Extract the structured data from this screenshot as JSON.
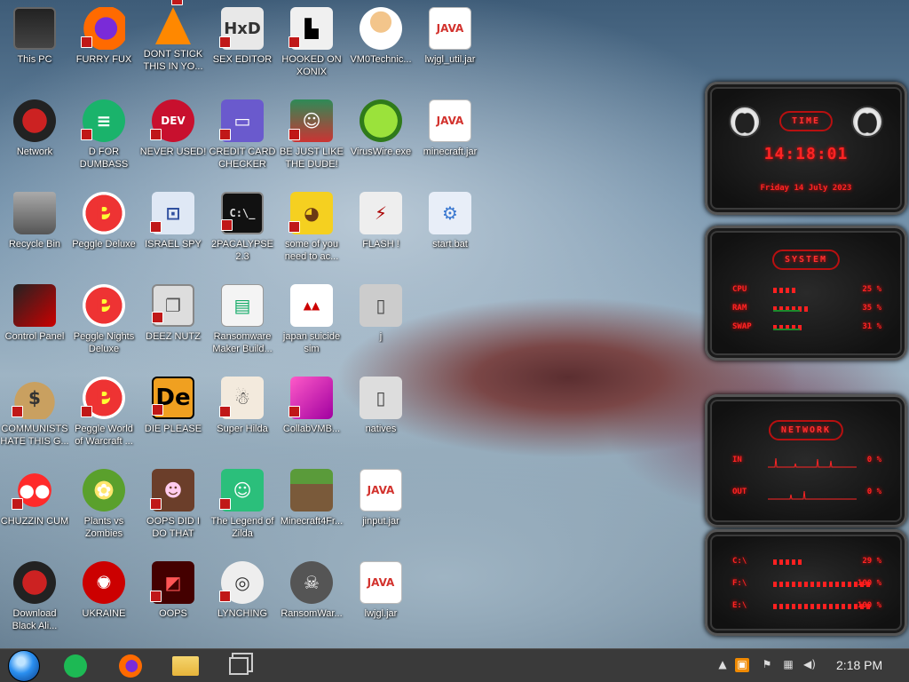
{
  "desktop": {
    "icons": [
      {
        "label": "This PC",
        "glyph": "",
        "style": "g-pc",
        "shortcut": false
      },
      {
        "label": "FURRY FUX",
        "glyph": "",
        "style": "g-fox",
        "shortcut": true
      },
      {
        "label": "DONT STICK THIS IN YO...",
        "glyph": "",
        "style": "g-vlc",
        "shortcut": true
      },
      {
        "label": "SEX EDITOR",
        "glyph": "HxD",
        "style": "g-hxd",
        "shortcut": true
      },
      {
        "label": "HOOKED ON XONIX",
        "glyph": "▙",
        "style": "g-hook",
        "shortcut": true
      },
      {
        "label": "VM0Technic...",
        "glyph": "",
        "style": "g-doc",
        "shortcut": false
      },
      {
        "label": "lwjgl_util.jar",
        "glyph": "JAVA",
        "style": "g-java",
        "shortcut": false
      },
      {
        "label": "Network",
        "glyph": "",
        "style": "g-net",
        "shortcut": false
      },
      {
        "label": "D FOR DUMBASS",
        "glyph": "≡",
        "style": "g-green",
        "shortcut": true
      },
      {
        "label": "NEVER USED!",
        "glyph": "DEV",
        "style": "g-dev",
        "shortcut": true
      },
      {
        "label": "CREDIT CARD CHECKER",
        "glyph": "▭",
        "style": "g-card",
        "shortcut": true
      },
      {
        "label": "BE JUST LIKE THE DUDE!",
        "glyph": "☺",
        "style": "g-elf",
        "shortcut": true
      },
      {
        "label": "VirusWire.exe",
        "glyph": "",
        "style": "g-lime",
        "shortcut": false
      },
      {
        "label": "minecraft.jar",
        "glyph": "JAVA",
        "style": "g-java",
        "shortcut": false
      },
      {
        "label": "Recycle Bin",
        "glyph": "",
        "style": "g-bin",
        "shortcut": false
      },
      {
        "label": "Peggle Deluxe",
        "glyph": "P",
        "style": "g-peggle",
        "shortcut": false
      },
      {
        "label": "ISRAEL SPY",
        "glyph": "⊡",
        "style": "g-spy",
        "shortcut": true
      },
      {
        "label": "2PACALYPSE 2.3",
        "glyph": "C:\\_",
        "style": "g-cmd",
        "shortcut": true
      },
      {
        "label": "some of you need to ac...",
        "glyph": "◕",
        "style": "g-dog",
        "shortcut": true
      },
      {
        "label": "FLASH !",
        "glyph": "⚡",
        "style": "g-flash",
        "shortcut": false
      },
      {
        "label": "start.bat",
        "glyph": "⚙",
        "style": "g-gear",
        "shortcut": false
      },
      {
        "label": "Control Panel",
        "glyph": "",
        "style": "g-cp",
        "shortcut": false
      },
      {
        "label": "Peggle Nights Deluxe",
        "glyph": "P",
        "style": "g-peggle",
        "shortcut": false
      },
      {
        "label": "DEEZ NUTZ",
        "glyph": "❐",
        "style": "g-deez",
        "shortcut": true
      },
      {
        "label": "Ransomware Maker Build...",
        "glyph": "▤",
        "style": "g-rmb",
        "shortcut": false
      },
      {
        "label": "japan suicide sim",
        "glyph": "▲▲",
        "style": "g-japan",
        "shortcut": false
      },
      {
        "label": "j",
        "glyph": "▯",
        "style": "g-j",
        "shortcut": false
      },
      {
        "label": "",
        "glyph": "",
        "style": "",
        "shortcut": false
      },
      {
        "label": "COMMUNISTS HATE THIS G...",
        "glyph": "$",
        "style": "g-money",
        "shortcut": true
      },
      {
        "label": "Peggle World of Warcraft ...",
        "glyph": "P",
        "style": "g-peggle",
        "shortcut": true
      },
      {
        "label": "DIE PLEASE",
        "glyph": "De",
        "style": "g-de",
        "shortcut": true
      },
      {
        "label": "Super Hilda",
        "glyph": "☃",
        "style": "g-hilda",
        "shortcut": true
      },
      {
        "label": "CollabVMB...",
        "glyph": "",
        "style": "g-collab",
        "shortcut": true
      },
      {
        "label": "natives",
        "glyph": "▯",
        "style": "g-nat",
        "shortcut": false
      },
      {
        "label": "",
        "glyph": "",
        "style": "",
        "shortcut": false
      },
      {
        "label": "CHUZZIN CUM",
        "glyph": "●●",
        "style": "g-chuz",
        "shortcut": true
      },
      {
        "label": "Plants vs Zombies",
        "glyph": "✿",
        "style": "g-pvz",
        "shortcut": false
      },
      {
        "label": "OOPS DID I DO THAT",
        "glyph": "☻",
        "style": "g-oops",
        "shortcut": true
      },
      {
        "label": "The Legend of Zilda",
        "glyph": "☺",
        "style": "g-zilda",
        "shortcut": true
      },
      {
        "label": "Minecraft4Fr...",
        "glyph": "",
        "style": "g-mc",
        "shortcut": false
      },
      {
        "label": "jinput.jar",
        "glyph": "JAVA",
        "style": "g-java",
        "shortcut": false
      },
      {
        "label": "",
        "glyph": "",
        "style": "",
        "shortcut": false
      },
      {
        "label": "Download Black Ali...",
        "glyph": "",
        "style": "g-net",
        "shortcut": false
      },
      {
        "label": "UKRAINE",
        "glyph": "☢",
        "style": "g-rad",
        "shortcut": false
      },
      {
        "label": "OOPS",
        "glyph": "◩",
        "style": "g-oops2",
        "shortcut": true
      },
      {
        "label": "LYNCHING",
        "glyph": "◎",
        "style": "g-lynch",
        "shortcut": true
      },
      {
        "label": "RansomWar...",
        "glyph": "☠",
        "style": "g-skull",
        "shortcut": false
      },
      {
        "label": "lwjgl.jar",
        "glyph": "JAVA",
        "style": "g-java",
        "shortcut": false
      },
      {
        "label": "",
        "glyph": "",
        "style": "",
        "shortcut": false
      }
    ]
  },
  "widgets": {
    "time": {
      "title": "TIME",
      "clock": "14:18:01",
      "date": "Friday 14 July 2023"
    },
    "system": {
      "title": "SYSTEM",
      "rows": [
        {
          "label": "CPU",
          "value": "25 %",
          "fill": 0.25
        },
        {
          "label": "RAM",
          "value": "35 %",
          "fill": 0.35
        },
        {
          "label": "SWAP",
          "value": "31 %",
          "fill": 0.31
        }
      ]
    },
    "network": {
      "title": "NETWORK",
      "rows": [
        {
          "label": "IN",
          "value": "0 %"
        },
        {
          "label": "OUT",
          "value": "0 %"
        }
      ]
    },
    "drives": {
      "rows": [
        {
          "label": "C:\\",
          "value": "29 %",
          "fill": 0.29
        },
        {
          "label": "F:\\",
          "value": "100 %",
          "fill": 1.0
        },
        {
          "label": "E:\\",
          "value": "100 %",
          "fill": 1.0
        }
      ]
    }
  },
  "taskbar": {
    "clock": "2:18 PM",
    "tray": [
      "▲",
      "▣",
      "⚑",
      "▦",
      "◀)"
    ],
    "colors": {
      "bg": "#3a3a3a",
      "accent": "#ff2424"
    }
  }
}
